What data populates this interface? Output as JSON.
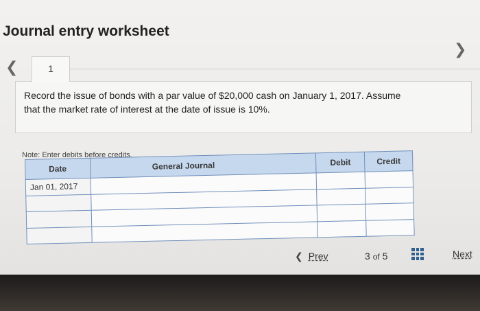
{
  "header": {
    "title": "Journal entry worksheet"
  },
  "tabs": [
    {
      "label": "1"
    }
  ],
  "question": {
    "text": "Record the issue of bonds with a par value of $20,000 cash on January 1, 2017. Assume that the market rate of interest at the date of issue is 10%."
  },
  "note": "Note: Enter debits before credits.",
  "journal": {
    "columns": [
      "Date",
      "General Journal",
      "Debit",
      "Credit"
    ],
    "rows": [
      {
        "date": "Jan 01, 2017",
        "account": "",
        "debit": "",
        "credit": ""
      },
      {
        "date": "",
        "account": "",
        "debit": "",
        "credit": ""
      },
      {
        "date": "",
        "account": "",
        "debit": "",
        "credit": ""
      },
      {
        "date": "",
        "account": "",
        "debit": "",
        "credit": ""
      }
    ]
  },
  "footer": {
    "prev_label": "Prev",
    "page_current": "3",
    "page_of": "of",
    "page_total": "5",
    "next_label": "Next"
  },
  "icons": {
    "left_nav": "chevron-left-icon",
    "right_nav": "chevron-right-icon",
    "grid": "grid-icon"
  },
  "colors": {
    "table_header": "#c6d8ee",
    "table_border": "#6f8fbb",
    "grid_icon": "#2f5f8f"
  }
}
